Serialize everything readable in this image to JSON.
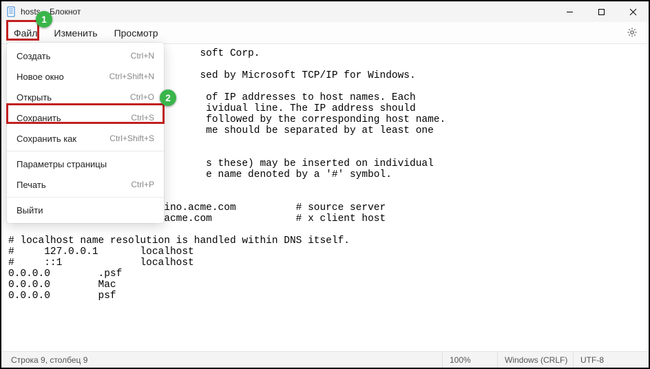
{
  "window": {
    "title": "hosts – Блокнот"
  },
  "menubar": {
    "file": "Файл",
    "edit": "Изменить",
    "view": "Просмотр"
  },
  "dropdown": {
    "items": [
      {
        "label": "Создать",
        "shortcut": "Ctrl+N"
      },
      {
        "label": "Новое окно",
        "shortcut": "Ctrl+Shift+N"
      },
      {
        "label": "Открыть",
        "shortcut": "Ctrl+O"
      },
      {
        "label": "Сохранить",
        "shortcut": "Ctrl+S"
      },
      {
        "label": "Сохранить как",
        "shortcut": "Ctrl+Shift+S"
      },
      {
        "label": "Параметры страницы",
        "shortcut": ""
      },
      {
        "label": "Печать",
        "shortcut": "Ctrl+P"
      },
      {
        "label": "Выйти",
        "shortcut": ""
      }
    ]
  },
  "editor": {
    "text": "                                soft Corp.\n#\n                                sed by Microsoft TCP/IP for Windows.\n#\n                                 of IP addresses to host names. Each\n                                 ividual line. The IP address should\n                                 followed by the corresponding host name.\n                                 me should be separated by at least one\n#\n#\n                                 s these) may be inserted on individual\n                                 e name denoted by a '#' symbol.\n#\n#\n#      102.54.94.97     rhino.acme.com          # source server\n#       38.25.63.10     x.acme.com              # x client host\n\n# localhost name resolution is handled within DNS itself.\n#     127.0.0.1       localhost\n#     ::1             localhost\n0.0.0.0        .psf\n0.0.0.0        Mac\n0.0.0.0        psf"
  },
  "statusbar": {
    "position": "Строка 9, столбец 9",
    "zoom": "100%",
    "lineending": "Windows (CRLF)",
    "encoding": "UTF-8"
  },
  "annotations": {
    "marker1": "1",
    "marker2": "2"
  }
}
